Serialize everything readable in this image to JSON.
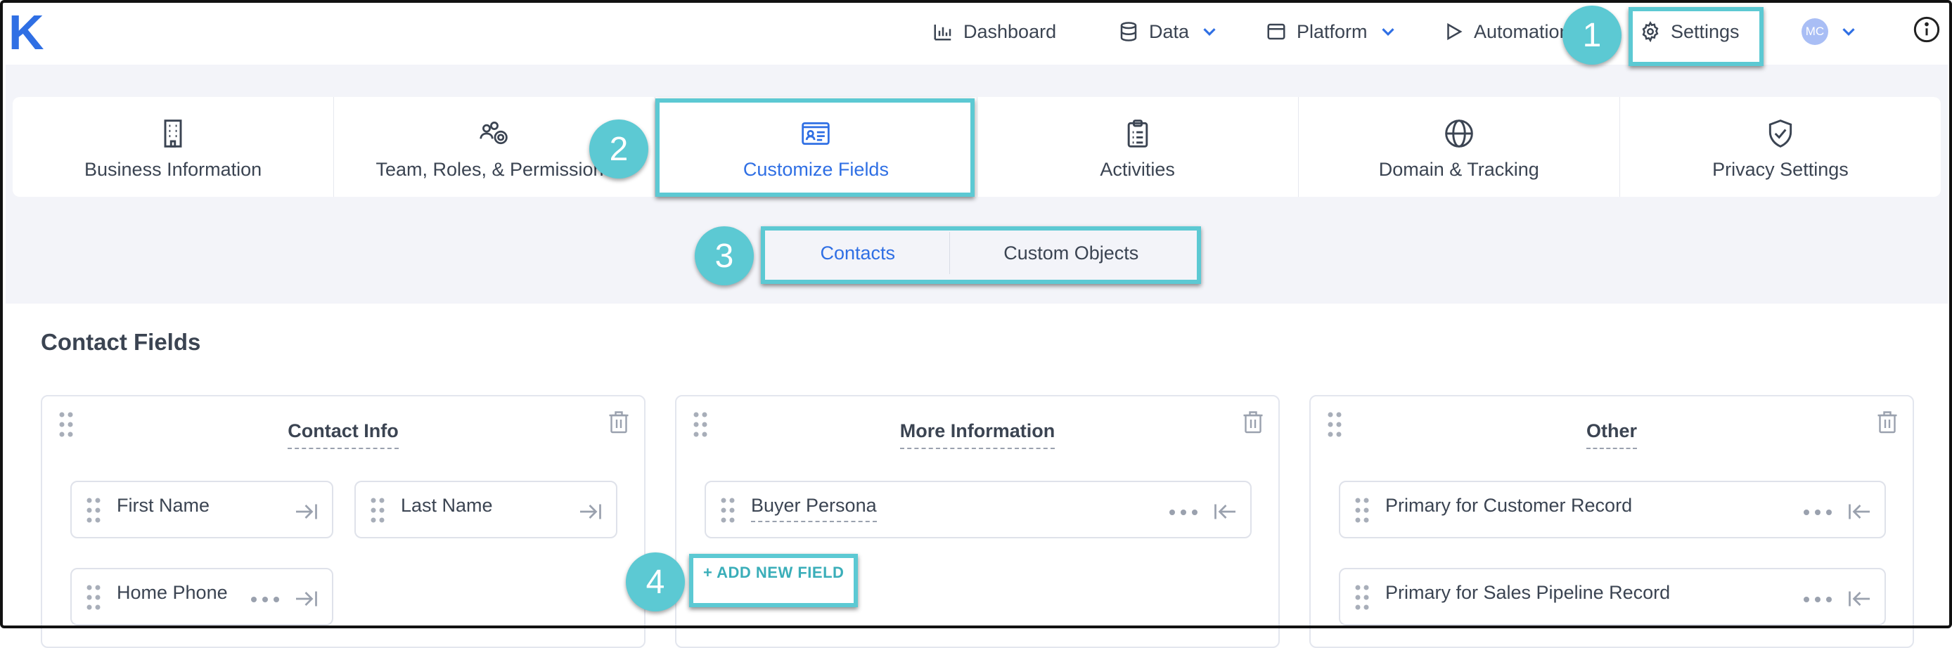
{
  "brand": {
    "logo_letter": "K"
  },
  "nav": {
    "dashboard": "Dashboard",
    "data": "Data",
    "platform": "Platform",
    "automation": "Automation",
    "settings": "Settings",
    "avatar_initials": "MC"
  },
  "categories": [
    {
      "label": "Business Information",
      "icon": "building-icon"
    },
    {
      "label": "Team, Roles, & Permissions",
      "icon": "team-gear-icon"
    },
    {
      "label": "Customize Fields",
      "icon": "id-card-icon"
    },
    {
      "label": "Activities",
      "icon": "clipboard-icon"
    },
    {
      "label": "Domain & Tracking",
      "icon": "globe-icon"
    },
    {
      "label": "Privacy Settings",
      "icon": "shield-check-icon"
    }
  ],
  "subtabs": {
    "contacts": "Contacts",
    "custom_objects": "Custom Objects"
  },
  "section_title": "Contact Fields",
  "groups": [
    {
      "title": "Contact Info",
      "fields": [
        "First Name",
        "Last Name",
        "Home Phone"
      ]
    },
    {
      "title": "More Information",
      "fields": [
        "Buyer Persona"
      ],
      "add_label": "+ ADD NEW FIELD"
    },
    {
      "title": "Other",
      "fields": [
        "Primary for Customer Record",
        "Primary for Sales Pipeline Record"
      ]
    }
  ],
  "annotations": [
    "1",
    "2",
    "3",
    "4"
  ],
  "colors": {
    "accent": "#2f6fe4",
    "highlight": "#5cc9d3",
    "add_link": "#3aaeb9"
  }
}
